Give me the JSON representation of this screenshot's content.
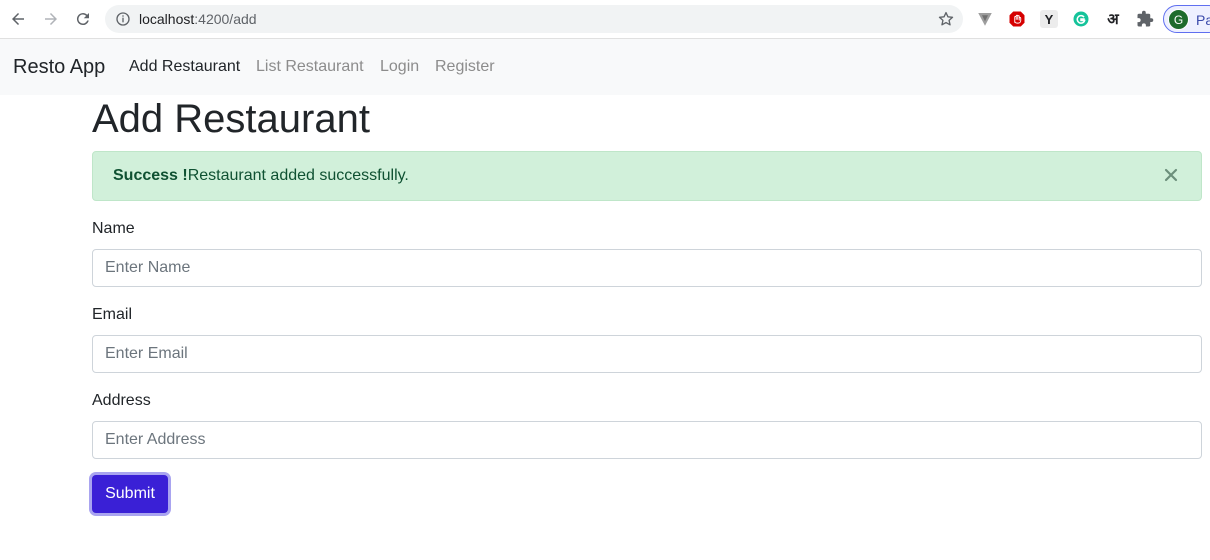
{
  "browser": {
    "url_host": "localhost",
    "url_path": ":4200/add",
    "profile_initial": "G",
    "profile_text": "Pa",
    "extensions": [
      "vpn-icon",
      "adblock-icon",
      "y-extension-icon",
      "grammarly-icon",
      "hindi-input-icon",
      "extensions-puzzle-icon"
    ],
    "ext_y_label": "Y",
    "ext_hindi_label": "अ"
  },
  "navbar": {
    "brand": "Resto App",
    "links": [
      {
        "label": "Add Restaurant",
        "active": true
      },
      {
        "label": "List Restaurant",
        "active": false
      },
      {
        "label": "Login",
        "active": false
      },
      {
        "label": "Register",
        "active": false
      }
    ]
  },
  "page": {
    "title": "Add Restaurant",
    "alert": {
      "strong": "Success !",
      "message": "Restaurant added successfully."
    },
    "form": {
      "name_label": "Name",
      "name_placeholder": "Enter Name",
      "email_label": "Email",
      "email_placeholder": "Enter Email",
      "address_label": "Address",
      "address_placeholder": "Enter Address",
      "submit_label": "Submit"
    }
  },
  "colors": {
    "submit_bg": "#3a20d6",
    "alert_bg": "#d1f0da",
    "alert_text": "#0f5132",
    "navbar_bg": "#f8f9fa"
  }
}
